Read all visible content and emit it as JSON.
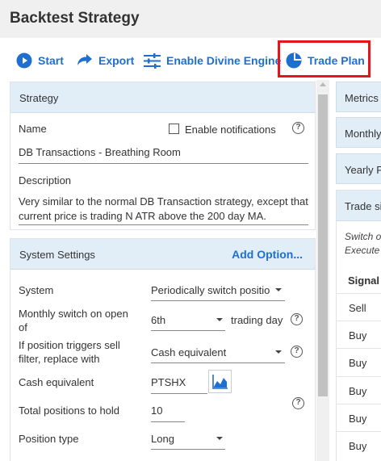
{
  "window": {
    "title": "Backtest Strategy"
  },
  "toolbar": {
    "start_label": "Start",
    "export_label": "Export",
    "divine_label": "Enable Divine Engine",
    "trade_plan_label": "Trade Plan"
  },
  "strategy": {
    "panel_title": "Strategy",
    "name_label": "Name",
    "enable_notifications_label": "Enable notifications",
    "name_value": "DB Transactions - Breathing Room",
    "description_label": "Description",
    "description_line1": "Very similar to the normal DB Transaction strategy, except that",
    "description_line2": "current price is trading N ATR above the 200 day MA."
  },
  "system_settings": {
    "panel_title": "System Settings",
    "add_option_label": "Add Option...",
    "system_label": "System",
    "system_value": "Periodically switch positio",
    "monthly_label_1": "Monthly switch on open",
    "monthly_label_2": "of",
    "monthly_value": "6th",
    "trading_day_label": "trading day",
    "sell_filter_label_1": "If position triggers sell",
    "sell_filter_label_2": "filter, replace with",
    "sell_filter_value": "Cash equivalent",
    "cash_equivalent_label": "Cash equivalent",
    "cash_equivalent_value": "PTSHX",
    "total_positions_label": "Total positions to hold",
    "total_positions_value": "10",
    "position_type_label": "Position type",
    "position_type_value": "Long"
  },
  "right_pane": {
    "metrics_tab": "Metrics",
    "monthly_tab": "Monthly",
    "yearly_tab": "Yearly P",
    "trade_signals_title": "Trade sig",
    "note_line1": "Switch o",
    "note_line2": "Execute",
    "signal_col": "Signal",
    "signals": [
      "Sell",
      "Buy",
      "Buy",
      "Buy",
      "Buy",
      "Buy"
    ]
  },
  "colors": {
    "accent": "#1f6fd1",
    "panel_header": "#e1eef8",
    "highlight": "#e5151d"
  },
  "icons": {
    "start": "play-circle-icon",
    "export": "share-arrow-icon",
    "divine": "sliders-icon",
    "trade_plan": "pie-chart-icon",
    "help": "question-circle-icon",
    "chart": "line-chart-icon"
  }
}
